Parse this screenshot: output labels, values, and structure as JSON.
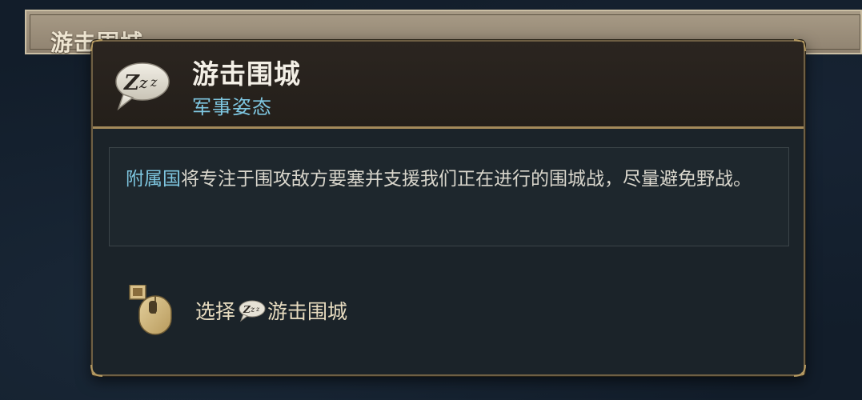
{
  "background": {
    "bar_title": "游击围城"
  },
  "tooltip": {
    "icon": "zzz-speech-bubble-icon",
    "title": "游击围城",
    "subtitle": "军事姿态",
    "description": {
      "highlight": "附属国",
      "text": "将专注于围攻敌方要塞并支援我们正在进行的围城战，尽量避免野战。"
    },
    "action": {
      "icon": "mouse-left-click-icon",
      "prefix": "选择",
      "inline_icon": "zzz-speech-bubble-icon",
      "label": "游击围城"
    }
  },
  "colors": {
    "highlight": "#7ec6e0",
    "border_gold": "#a48a5a",
    "title_white": "#f3efe6"
  }
}
